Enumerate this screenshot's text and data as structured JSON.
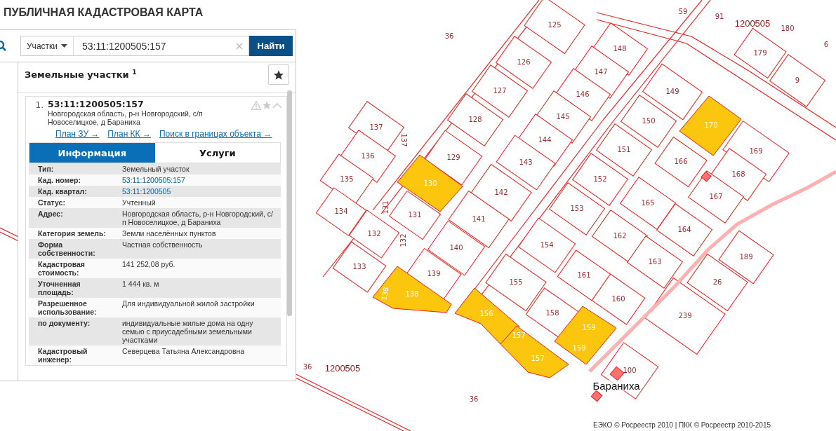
{
  "app_title": "ПУБЛИЧНАЯ КАДАСТРОВАЯ КАРТА",
  "search": {
    "type_dropdown": "Участки",
    "value": "53:11:1200505:157",
    "search_button": "Найти"
  },
  "results": {
    "heading": "Земельные участки",
    "count": "1",
    "items": [
      {
        "number": "1.",
        "cadastral_number": "53:11:1200505:157",
        "address": "Новгородская область, р-н Новгородский, с/п Новоселицкое, д Бараниха",
        "expanded": true,
        "links": [
          "План ЗУ →",
          "План КК →",
          "Поиск в границах объекта →"
        ],
        "tabs": [
          {
            "label": "Информация",
            "selected": true
          },
          {
            "label": "Услуги",
            "selected": false
          }
        ],
        "fields": [
          {
            "label": "Тип:",
            "value": "Земельный участок",
            "link": false
          },
          {
            "label": "Кад. номер:",
            "value": "53:11:1200505:157",
            "link": true
          },
          {
            "label": "Кад. квартал:",
            "value": "53:11:1200505",
            "link": true
          },
          {
            "label": "Статус:",
            "value": "Учтенный",
            "link": false
          },
          {
            "label": "Адрес:",
            "value": "Новгородская область, р-н Новгородский, с/п Новоселицкое, д Бараниха",
            "link": false
          },
          {
            "label": "Категория земель:",
            "value": "Земли населённых пунктов",
            "link": false
          },
          {
            "label": "Форма собственности:",
            "value": "Частная собственность",
            "link": false
          },
          {
            "label": "Кадастровая стоимость:",
            "value": "141 252,08 руб.",
            "link": false
          },
          {
            "label": "Уточненная площадь:",
            "value": "1 444 кв. м",
            "link": false
          },
          {
            "label": "Разрешенное использование:",
            "value": "Для индивидуальной жилой застройки",
            "link": false
          },
          {
            "label": "по документу:",
            "value": "индивидуальные жилые дома на одну семью с приусадебными земельными участками",
            "link": false
          },
          {
            "label": "Кадастровый инженер:",
            "value": "Северцева Татьяна Александровна",
            "link": false
          }
        ]
      }
    ]
  },
  "map": {
    "labels": [
      {
        "text": "36",
        "kind": "parcel",
        "highlighted": false
      },
      {
        "text": "125",
        "kind": "parcel",
        "highlighted": false
      },
      {
        "text": "59",
        "kind": "parcel",
        "highlighted": false
      },
      {
        "text": "91",
        "kind": "parcel",
        "highlighted": false
      },
      {
        "text": "1200505",
        "kind": "block"
      },
      {
        "text": "180",
        "kind": "parcel",
        "highlighted": false
      },
      {
        "text": "6",
        "kind": "parcel",
        "highlighted": false
      },
      {
        "text": "179",
        "kind": "parcel",
        "highlighted": false
      },
      {
        "text": "148",
        "kind": "parcel",
        "highlighted": false
      },
      {
        "text": "126",
        "kind": "parcel",
        "highlighted": false
      },
      {
        "text": "147",
        "kind": "parcel",
        "highlighted": false
      },
      {
        "text": "9",
        "kind": "parcel",
        "highlighted": false
      },
      {
        "text": "127",
        "kind": "parcel",
        "highlighted": false
      },
      {
        "text": "146",
        "kind": "parcel",
        "highlighted": false
      },
      {
        "text": "149",
        "kind": "parcel",
        "highlighted": false
      },
      {
        "text": "145",
        "kind": "parcel",
        "highlighted": false
      },
      {
        "text": "128",
        "kind": "parcel",
        "highlighted": false
      },
      {
        "text": "150",
        "kind": "parcel",
        "highlighted": false
      },
      {
        "text": "170",
        "kind": "parcel",
        "highlighted": true
      },
      {
        "text": "137",
        "kind": "parcel",
        "highlighted": false
      },
      {
        "text": "137",
        "kind": "parcel",
        "highlighted": false
      },
      {
        "text": "144",
        "kind": "parcel",
        "highlighted": false
      },
      {
        "text": "169",
        "kind": "parcel",
        "highlighted": false
      },
      {
        "text": "136",
        "kind": "parcel",
        "highlighted": false
      },
      {
        "text": "151",
        "kind": "parcel",
        "highlighted": false
      },
      {
        "text": "166",
        "kind": "parcel",
        "highlighted": false
      },
      {
        "text": "129",
        "kind": "parcel",
        "highlighted": false
      },
      {
        "text": "143",
        "kind": "parcel",
        "highlighted": false
      },
      {
        "text": "168",
        "kind": "parcel",
        "highlighted": false
      },
      {
        "text": "152",
        "kind": "parcel",
        "highlighted": false
      },
      {
        "text": "135",
        "kind": "parcel",
        "highlighted": false
      },
      {
        "text": "130",
        "kind": "parcel",
        "highlighted": true
      },
      {
        "text": "142",
        "kind": "parcel",
        "highlighted": false
      },
      {
        "text": "167",
        "kind": "parcel",
        "highlighted": false
      },
      {
        "text": "165",
        "kind": "parcel",
        "highlighted": false
      },
      {
        "text": "134",
        "kind": "parcel",
        "highlighted": false
      },
      {
        "text": "153",
        "kind": "parcel",
        "highlighted": false
      },
      {
        "text": "131",
        "kind": "parcel",
        "highlighted": false
      },
      {
        "text": "131",
        "kind": "parcel",
        "highlighted": false
      },
      {
        "text": "141",
        "kind": "parcel",
        "highlighted": false
      },
      {
        "text": "164",
        "kind": "parcel",
        "highlighted": false
      },
      {
        "text": "132",
        "kind": "parcel",
        "highlighted": false
      },
      {
        "text": "132",
        "kind": "parcel",
        "highlighted": false
      },
      {
        "text": "162",
        "kind": "parcel",
        "highlighted": false
      },
      {
        "text": "140",
        "kind": "parcel",
        "highlighted": false
      },
      {
        "text": "154",
        "kind": "parcel",
        "highlighted": false
      },
      {
        "text": "163",
        "kind": "parcel",
        "highlighted": false
      },
      {
        "text": "189",
        "kind": "parcel",
        "highlighted": false
      },
      {
        "text": "133",
        "kind": "parcel",
        "highlighted": false
      },
      {
        "text": "161",
        "kind": "parcel",
        "highlighted": false
      },
      {
        "text": "139",
        "kind": "parcel",
        "highlighted": false
      },
      {
        "text": "155",
        "kind": "parcel",
        "highlighted": false
      },
      {
        "text": "26",
        "kind": "parcel",
        "highlighted": false
      },
      {
        "text": "138",
        "kind": "parcel",
        "highlighted": true
      },
      {
        "text": "138",
        "kind": "parcel",
        "highlighted": true
      },
      {
        "text": "160",
        "kind": "parcel",
        "highlighted": false
      },
      {
        "text": "156",
        "kind": "parcel",
        "highlighted": true
      },
      {
        "text": "158",
        "kind": "parcel",
        "highlighted": false
      },
      {
        "text": "239",
        "kind": "parcel",
        "highlighted": false
      },
      {
        "text": "159",
        "kind": "parcel",
        "highlighted": true
      },
      {
        "text": "157",
        "kind": "parcel",
        "highlighted": true
      },
      {
        "text": "159",
        "kind": "parcel",
        "highlighted": true
      },
      {
        "text": "157",
        "kind": "parcel",
        "highlighted": true
      },
      {
        "text": "100",
        "kind": "parcel",
        "highlighted": false
      },
      {
        "text": "36",
        "kind": "parcel",
        "highlighted": false
      },
      {
        "text": "1200505",
        "kind": "block"
      },
      {
        "text": "Бараниха",
        "kind": "place"
      },
      {
        "text": "36",
        "kind": "parcel",
        "highlighted": false
      }
    ],
    "attribution": "ЕЭКО © Росреестр 2010 | ПКК © Росреестр 2010-2015"
  }
}
